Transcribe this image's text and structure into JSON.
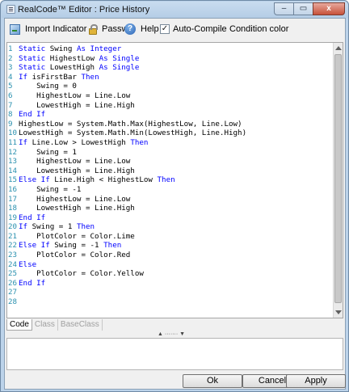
{
  "window": {
    "title": "RealCode™ Editor : Price History",
    "controls": {
      "minimize": "–",
      "maximize": "▭",
      "close": "x"
    }
  },
  "toolbar": {
    "import_label": "Import Indicator",
    "password_label": "Passwc",
    "help_label": "Help",
    "auto_compile_label": "Auto-Compile",
    "auto_compile_checked": "✓",
    "condition_color_label": "Condition color"
  },
  "editor": {
    "lines": [
      {
        "n": "1",
        "indent": "",
        "tokens": [
          [
            "kw",
            "Static "
          ],
          [
            "t",
            "Swing "
          ],
          [
            "kw",
            "As Integer"
          ]
        ]
      },
      {
        "n": "2",
        "indent": "",
        "tokens": [
          [
            "kw",
            "Static "
          ],
          [
            "t",
            "HighestLow "
          ],
          [
            "kw",
            "As Single"
          ]
        ]
      },
      {
        "n": "3",
        "indent": "",
        "tokens": [
          [
            "kw",
            "Static "
          ],
          [
            "t",
            "LowestHigh "
          ],
          [
            "kw",
            "As Single"
          ]
        ]
      },
      {
        "n": "4",
        "indent": "",
        "tokens": [
          [
            "kw",
            "If "
          ],
          [
            "t",
            "isFirstBar "
          ],
          [
            "kw",
            "Then"
          ]
        ]
      },
      {
        "n": "5",
        "indent": "    ",
        "tokens": [
          [
            "t",
            "Swing = 0"
          ]
        ]
      },
      {
        "n": "6",
        "indent": "    ",
        "tokens": [
          [
            "t",
            "HighestLow = Line.Low"
          ]
        ]
      },
      {
        "n": "7",
        "indent": "    ",
        "tokens": [
          [
            "t",
            "LowestHigh = Line.High"
          ]
        ]
      },
      {
        "n": "8",
        "indent": "",
        "tokens": [
          [
            "kw",
            "End If"
          ]
        ]
      },
      {
        "n": "9",
        "indent": "",
        "tokens": [
          [
            "t",
            "HighestLow = System.Math.Max(HighestLow, Line.Low)"
          ]
        ]
      },
      {
        "n": "10",
        "indent": "",
        "tokens": [
          [
            "t",
            "LowestHigh = System.Math.Min(LowestHigh, Line.High)"
          ]
        ]
      },
      {
        "n": "11",
        "indent": "",
        "tokens": [
          [
            "kw",
            "If "
          ],
          [
            "t",
            "Line.Low > LowestHigh "
          ],
          [
            "kw",
            "Then"
          ]
        ]
      },
      {
        "n": "12",
        "indent": "    ",
        "tokens": [
          [
            "t",
            "Swing = 1"
          ]
        ]
      },
      {
        "n": "13",
        "indent": "    ",
        "tokens": [
          [
            "t",
            "HighestLow = Line.Low"
          ]
        ]
      },
      {
        "n": "14",
        "indent": "    ",
        "tokens": [
          [
            "t",
            "LowestHigh = Line.High"
          ]
        ]
      },
      {
        "n": "15",
        "indent": "",
        "tokens": [
          [
            "kw",
            "Else If "
          ],
          [
            "t",
            "Line.High < HighestLow "
          ],
          [
            "kw",
            "Then"
          ]
        ]
      },
      {
        "n": "16",
        "indent": "    ",
        "tokens": [
          [
            "t",
            "Swing = -1"
          ]
        ]
      },
      {
        "n": "17",
        "indent": "    ",
        "tokens": [
          [
            "t",
            "HighestLow = Line.Low"
          ]
        ]
      },
      {
        "n": "18",
        "indent": "    ",
        "tokens": [
          [
            "t",
            "LowestHigh = Line.High"
          ]
        ]
      },
      {
        "n": "19",
        "indent": "",
        "tokens": [
          [
            "kw",
            "End If"
          ]
        ]
      },
      {
        "n": "20",
        "indent": "",
        "tokens": [
          [
            "kw",
            "If "
          ],
          [
            "t",
            "Swing = 1 "
          ],
          [
            "kw",
            "Then"
          ]
        ]
      },
      {
        "n": "21",
        "indent": "    ",
        "tokens": [
          [
            "t",
            "PlotColor = Color.Lime"
          ]
        ]
      },
      {
        "n": "22",
        "indent": "",
        "tokens": [
          [
            "kw",
            "Else If "
          ],
          [
            "t",
            "Swing = -1 "
          ],
          [
            "kw",
            "Then"
          ]
        ]
      },
      {
        "n": "23",
        "indent": "    ",
        "tokens": [
          [
            "t",
            "PlotColor = Color.Red"
          ]
        ]
      },
      {
        "n": "24",
        "indent": "",
        "tokens": [
          [
            "kw",
            "Else"
          ]
        ]
      },
      {
        "n": "25",
        "indent": "    ",
        "tokens": [
          [
            "t",
            "PlotColor = Color.Yellow"
          ]
        ]
      },
      {
        "n": "26",
        "indent": "",
        "tokens": [
          [
            "kw",
            "End If"
          ]
        ]
      },
      {
        "n": "27",
        "indent": "",
        "tokens": []
      },
      {
        "n": "28",
        "indent": "",
        "tokens": []
      }
    ]
  },
  "tabs": [
    {
      "label": "Code",
      "active": true
    },
    {
      "label": "Class",
      "active": false
    },
    {
      "label": "BaseClass",
      "active": false
    }
  ],
  "splitter": {
    "grip": "▲ ······· ▼"
  },
  "buttons": {
    "ok": "Ok",
    "cancel": "Cancel",
    "apply": "Apply"
  },
  "colors": {
    "keyword": "#0000ff",
    "line_number": "#2b91af",
    "title_bar": "#bcd3ea"
  }
}
